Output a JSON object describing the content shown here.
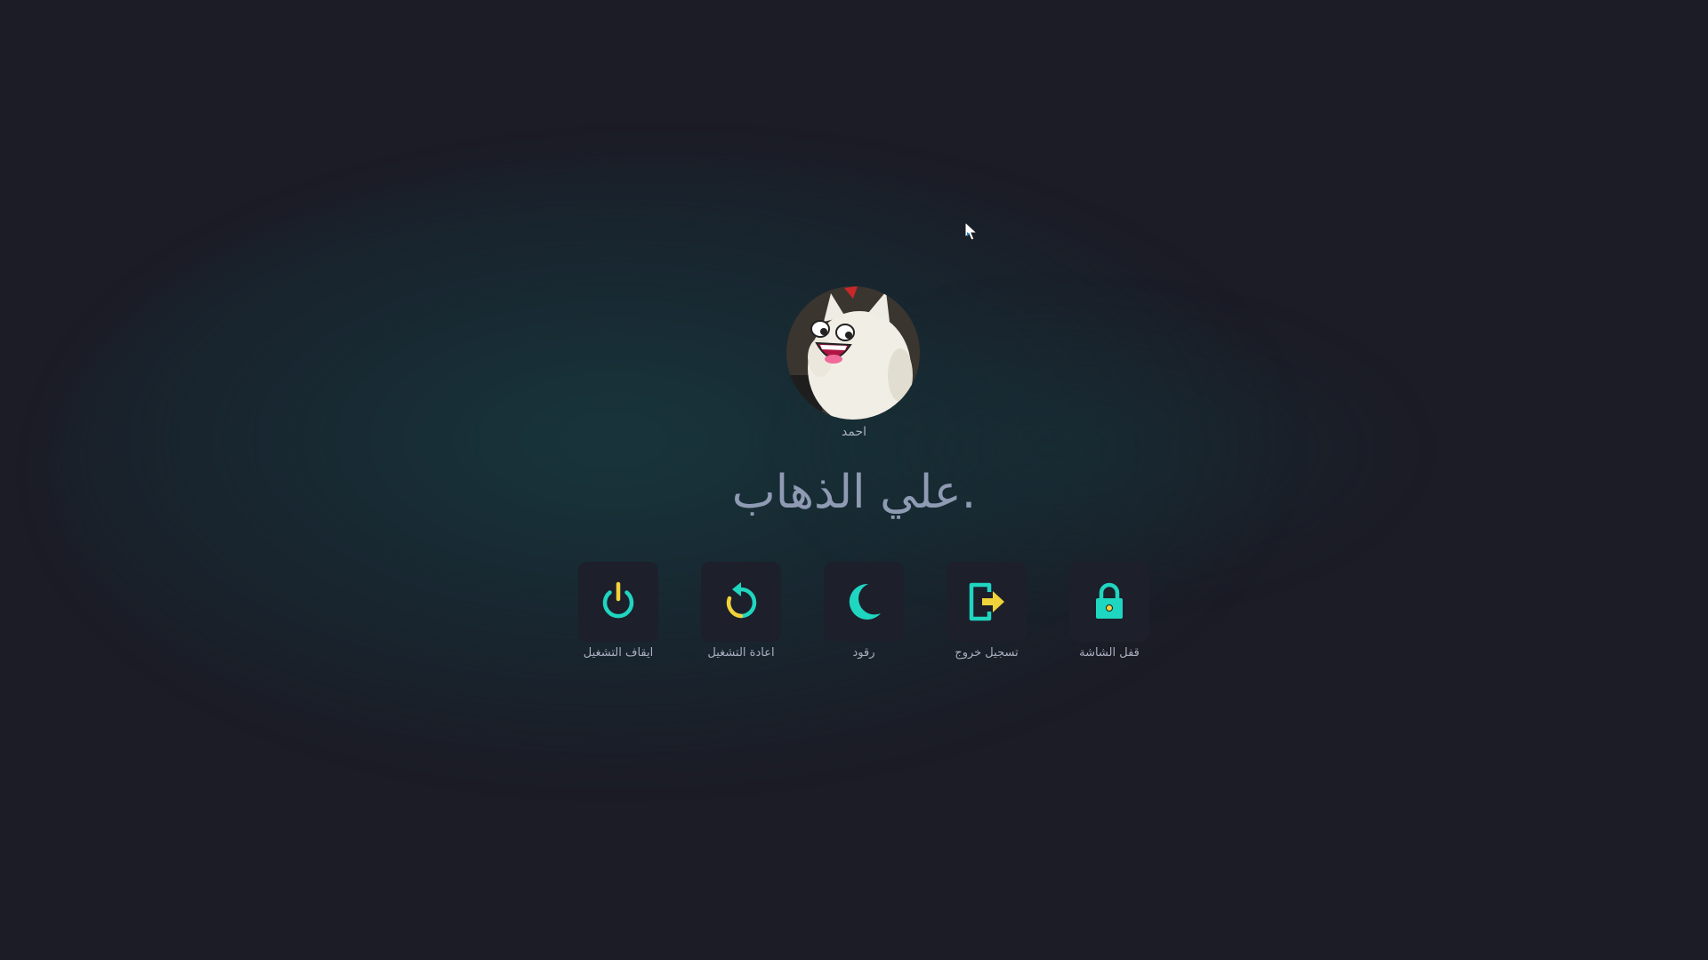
{
  "user": {
    "name": "احمد",
    "avatar": "cat-avatar"
  },
  "greeting": "علي الذهاب.",
  "actions": [
    {
      "label": "ايقاف التشغيل",
      "icon": "power-icon"
    },
    {
      "label": "اعادة التشغيل",
      "icon": "restart-icon"
    },
    {
      "label": "رقود",
      "icon": "moon-icon"
    },
    {
      "label": "تسجيل خروج",
      "icon": "logout-icon"
    },
    {
      "label": "قفل الشاشة",
      "icon": "lock-icon"
    }
  ],
  "colors": {
    "background": "#1b1c26",
    "accent": "#1fd6c0",
    "secondary_accent": "#f0d23a",
    "tile": "#1d1f2b",
    "text": "#aab0c0",
    "greeting_text": "#8f9ab3"
  }
}
